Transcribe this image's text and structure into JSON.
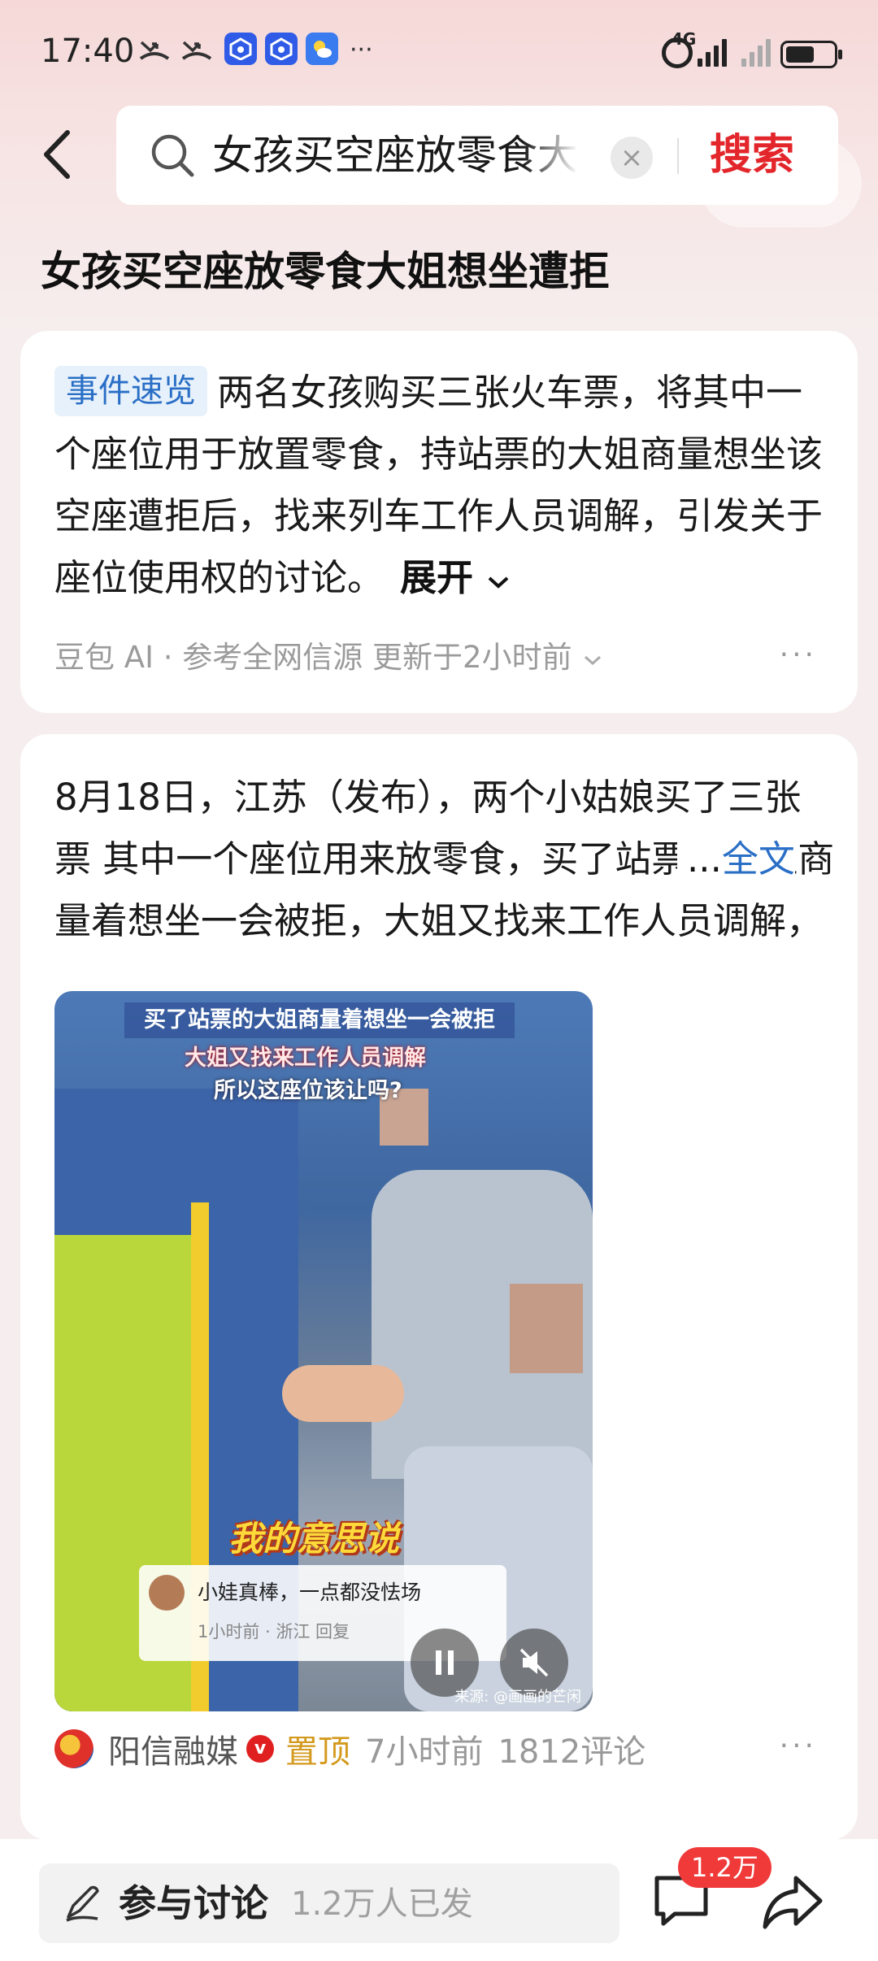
{
  "status_bar": {
    "time": "17:40",
    "network_4g": "4G",
    "icons": [
      "missed-call-icon",
      "missed-call-icon",
      "baidu-app-icon",
      "baidu-app-icon",
      "weather-app-icon",
      "more-icon",
      "alarm-icon",
      "signal-icon",
      "signal-icon",
      "battery-icon"
    ]
  },
  "header": {
    "search_query": "女孩买空座放零食大姐想坐遭拒",
    "search_button": "搜索",
    "clear_symbol": "×"
  },
  "page_title": "女孩买空座放零食大姐想坐遭拒",
  "summary": {
    "tag": "事件速览",
    "text": "两名女孩购买三张火车票，将其中一个座位用于放置零食，持站票的大姐商量想坐该空座遭拒后，找来列车工作人员调解，引发关于座位使用权的讨论。",
    "expand": "展开",
    "source": "豆包 AI · 参考全网信源 更新于2小时前"
  },
  "news": {
    "text": "8月18日，江苏（发布），两个小姑娘买了三张票 其中一个座位用来放零食，买了站票的大姐商量着想坐一会被拒，大姐又找来工作人员调解，所以这座位该让",
    "ellipsis": "...",
    "fulltext_link": "全文",
    "video": {
      "caption_top": "买了站票的大姐商量着想坐一会被拒",
      "caption_2": "大姐又找来工作人员调解",
      "caption_3": "所以这座位该让吗?",
      "sticker": "我的意思说",
      "comment_text": "小娃真棒，一点都没怯场",
      "comment_meta": "1小时前 · 浙江    回复",
      "source": "来源: @画画的芒闲"
    },
    "source_name": "阳信融媒",
    "verified_mark": "v",
    "pinned": "置顶",
    "time": "7小时前",
    "comments": "1812评论"
  },
  "bottom_bar": {
    "discuss_label": "参与讨论",
    "discuss_count": "1.2万人已发",
    "comment_badge": "1.2万"
  },
  "colors": {
    "accent_red": "#e3262b",
    "link_blue": "#2a6fc6",
    "pinned_gold": "#d49a1e",
    "badge_red": "#f03a3a"
  }
}
